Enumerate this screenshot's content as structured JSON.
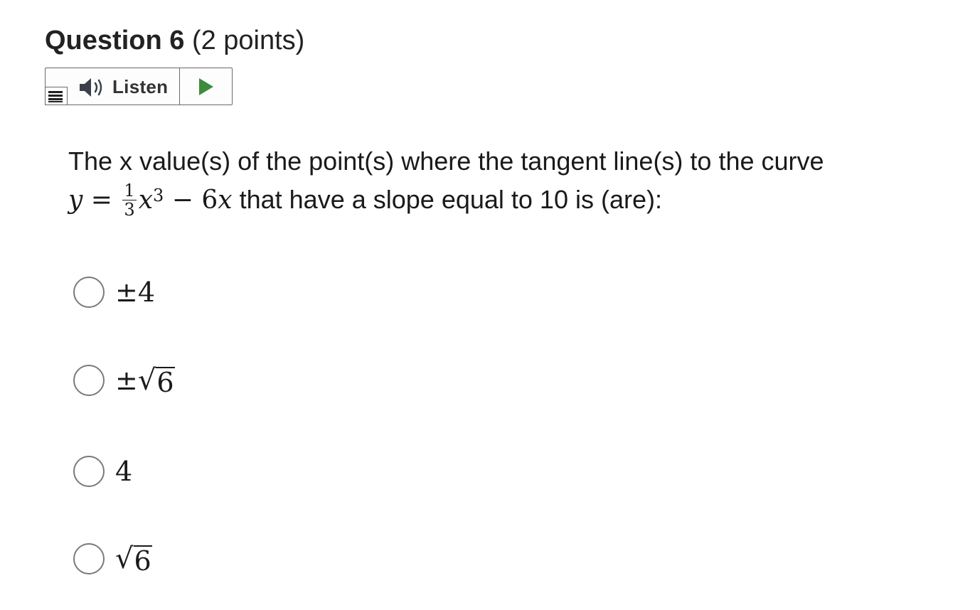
{
  "question": {
    "title": "Question 6",
    "points": "(2 points)"
  },
  "listen": {
    "label": "Listen",
    "menu_icon": "menu-icon",
    "speaker_icon": "speaker-icon",
    "play_icon": "play-icon",
    "play_color": "#3d8b3d"
  },
  "prompt": {
    "line1": "The x value(s) of the point(s) where the tangent line(s) to the curve",
    "eq_y": "y",
    "eq_equals": "=",
    "eq_num": "1",
    "eq_den": "3",
    "eq_x": "x",
    "eq_exp": "3",
    "eq_minus": "−",
    "eq_coef": "6",
    "eq_x2": "x",
    "line2_rest": "that have a slope equal to 10 is (are):"
  },
  "options": [
    {
      "prefix": "±4",
      "radicand": ""
    },
    {
      "prefix": "±",
      "radicand": "6"
    },
    {
      "prefix": "4",
      "radicand": ""
    },
    {
      "prefix": "",
      "radicand": "6"
    }
  ],
  "sqrt_symbol": "√",
  "selected_option": null
}
